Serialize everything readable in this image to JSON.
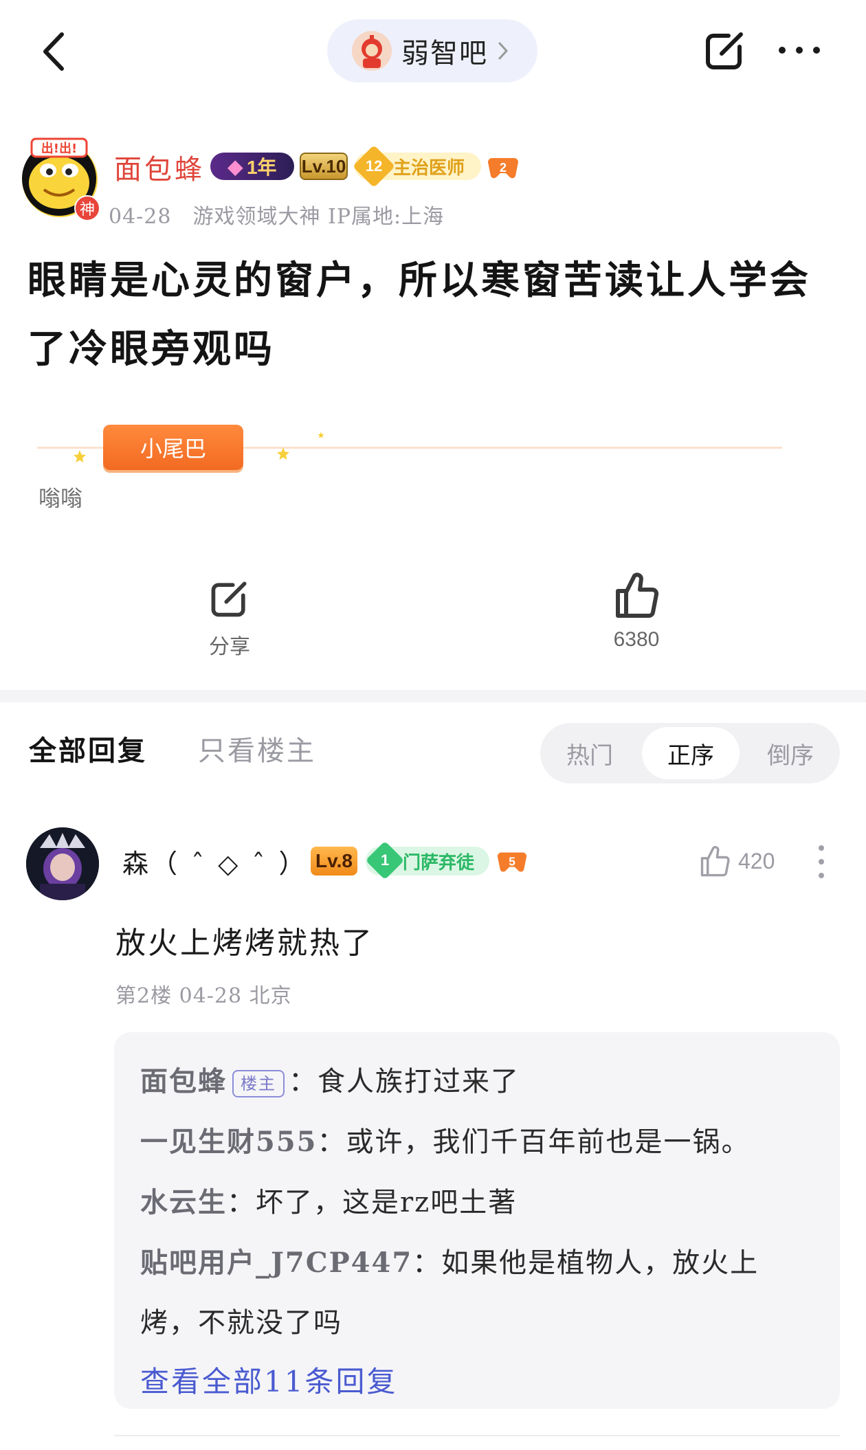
{
  "topbar": {
    "forum_name": "弱智吧"
  },
  "author": {
    "name": "面包蜂",
    "badge_year": "1年",
    "badge_level": "Lv.10",
    "badge_title_num": "12",
    "badge_title": "主治医师",
    "avatar_tag": "神",
    "meta": "04-28　游戏领域大神  IP属地:上海"
  },
  "post": {
    "title": "眼睛是心灵的窗户，所以寒窗苦读让人学会了冷眼旁观吗",
    "tail_label": "小尾巴",
    "tail_text": "嗡嗡",
    "share_label": "分享",
    "like_count": "6380"
  },
  "reply_tabs": {
    "all": "全部回复",
    "host_only": "只看楼主",
    "sort_hot": "热门",
    "sort_asc": "正序",
    "sort_desc": "倒序"
  },
  "reply": {
    "name": "森（ ˆ ◇ ˆ ）",
    "badge_level": "Lv.8",
    "badge_title_num": "1",
    "badge_title": "门萨弃徒",
    "like_count": "420",
    "body": "放火上烤烤就热了",
    "meta": "第2楼  04-28  北京",
    "sub_replies": [
      {
        "author": "面包蜂",
        "host_tag": "楼主",
        "text": "：食人族打过来了"
      },
      {
        "author": "一见生财555",
        "text": "：或许，我们千百年前也是一锅。"
      },
      {
        "author": "水云生",
        "text": "：坏了，这是rz吧土著"
      },
      {
        "author": "贴吧用户_J7CP447",
        "text": "：如果他是植物人，放火上烤，不就没了吗"
      }
    ],
    "view_all": "查看全部11条回复"
  },
  "colors": {
    "author_name": "#e0453a",
    "link": "#4a5ad0",
    "tail_badge": "#f26a22"
  }
}
